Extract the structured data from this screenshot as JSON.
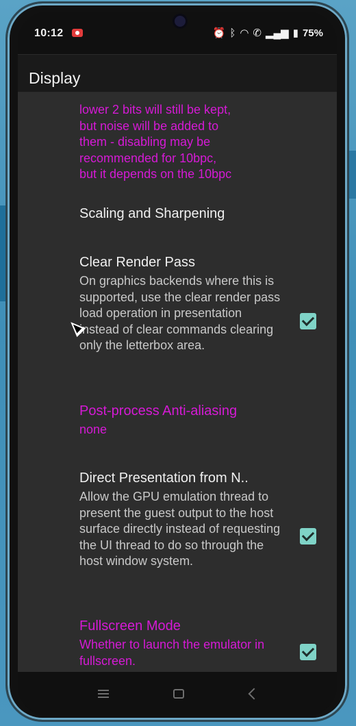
{
  "status_bar": {
    "time": "10:12",
    "battery": "75%",
    "icons": [
      "alarm-icon",
      "bluetooth-icon",
      "wifi-icon",
      "call-icon",
      "signal-icon",
      "battery-icon"
    ]
  },
  "app_bar": {
    "title": "Display"
  },
  "settings": {
    "dither_tail": {
      "description": "lower 2 bits will still be kept,\nbut noise will be added to\nthem - disabling may be\nrecommended for 10bpc,\nbut it depends on the 10bpc"
    },
    "scaling_header": {
      "title": "Scaling and Sharpening"
    },
    "clear_render_pass": {
      "title": "Clear Render Pass",
      "description": "On graphics backends where this is supported, use the clear render pass load operation in presentation instead of clear commands clearing only the letterbox area.",
      "checked": true
    },
    "post_process_aa": {
      "title": "Post-process Anti-aliasing",
      "value": "none"
    },
    "direct_presentation": {
      "title": "Direct Presentation from N..",
      "description": "Allow the GPU emulation thread to present the guest output to the host surface directly instead of requesting the UI thread to do so through the host window system.",
      "checked": true
    },
    "fullscreen_mode": {
      "title": "Fullscreen Mode",
      "description": "Whether to launch the emulator in fullscreen.",
      "checked": true
    }
  },
  "colors": {
    "accent_magenta": "#d51ad5",
    "checkbox_teal": "#7fd3c7",
    "surface": "#2d2d2d"
  }
}
